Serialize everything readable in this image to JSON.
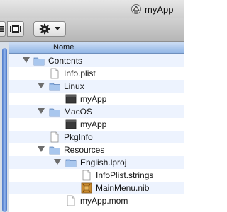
{
  "window": {
    "title": "myApp",
    "title_icon": "app-bundle-icon"
  },
  "toolbar": {
    "view_list_icon": "list-view-icon",
    "view_coverflow_icon": "coverflow-view-icon",
    "action_icon": "gear-icon",
    "action_dropdown_icon": "chevron-down-icon"
  },
  "header": {
    "name_column": "Nome"
  },
  "rows": [
    {
      "label": "Contents",
      "icon": "folder-icon",
      "expanded": true
    },
    {
      "label": "Info.plist",
      "icon": "document-icon"
    },
    {
      "label": "Linux",
      "icon": "folder-icon",
      "expanded": true
    },
    {
      "label": "myApp",
      "icon": "executable-icon"
    },
    {
      "label": "MacOS",
      "icon": "folder-icon",
      "expanded": true
    },
    {
      "label": "myApp",
      "icon": "executable-icon"
    },
    {
      "label": "PkgInfo",
      "icon": "document-icon"
    },
    {
      "label": "Resources",
      "icon": "folder-icon",
      "expanded": true
    },
    {
      "label": "English.lproj",
      "icon": "folder-icon",
      "expanded": true
    },
    {
      "label": "InfoPlist.strings",
      "icon": "document-icon"
    },
    {
      "label": "MainMenu.nib",
      "icon": "nib-icon"
    },
    {
      "label": "myApp.mom",
      "icon": "document-icon"
    }
  ],
  "colors": {
    "header_blue": "#a9c6ee",
    "alt_row": "#edf3fe",
    "folder_blue": "#8fb3e3",
    "scrollbar": "#5f8ad6"
  }
}
